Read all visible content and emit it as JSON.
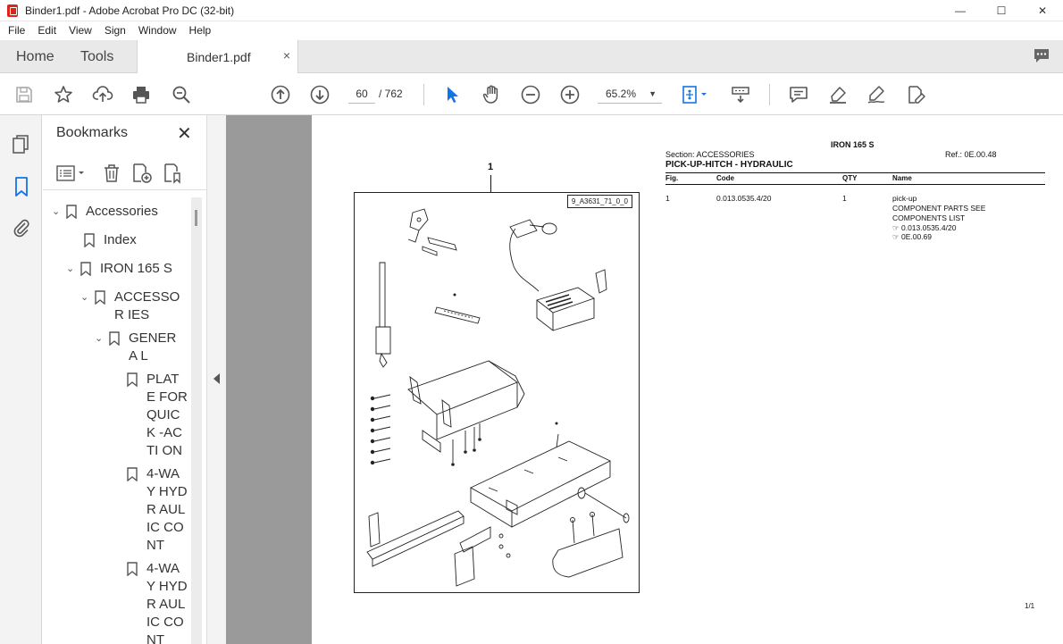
{
  "window": {
    "title": "Binder1.pdf - Adobe Acrobat Pro DC (32-bit)",
    "controls": [
      "—",
      "☐",
      "✕"
    ]
  },
  "menu": [
    "File",
    "Edit",
    "View",
    "Sign",
    "Window",
    "Help"
  ],
  "tabs": {
    "home": "Home",
    "tools": "Tools",
    "document": "Binder1.pdf",
    "close": "×"
  },
  "toolbar": {
    "page_current": "60",
    "page_total": "/  762",
    "zoom": "65.2%",
    "zoom_caret": "▼",
    "icons": [
      "save-icon",
      "star-icon",
      "upload-icon",
      "print-icon",
      "search-icon",
      "page-up-icon",
      "page-down-icon",
      "select-cursor-icon",
      "hand-icon",
      "zoom-out-icon",
      "zoom-in-icon",
      "fit-page-icon",
      "scroll-mode-icon",
      "comment-icon",
      "highlight-icon",
      "sign-icon",
      "edit-pdf-icon"
    ]
  },
  "bookmarks": {
    "title": "Bookmarks",
    "close": "✕",
    "items": [
      {
        "label": "Accessories",
        "chev": "⌄"
      },
      {
        "label": "Index",
        "chev": ""
      },
      {
        "label": "IRON 165 S",
        "chev": "⌄"
      },
      {
        "label": "ACCESSOR IES",
        "chev": "⌄"
      },
      {
        "label": "GENERA L",
        "chev": "⌄"
      },
      {
        "label": "PLATE FOR QUICK -ACTI ON",
        "chev": ""
      },
      {
        "label": "4-WA Y HYDR AULIC CONT",
        "chev": ""
      },
      {
        "label": "4-WA Y HYDR AULIC CONT",
        "chev": ""
      }
    ]
  },
  "pdf": {
    "model": "IRON 165 S",
    "section": "Section: ACCESSORIES",
    "ref": "Ref.: 0E.00.48",
    "heading": "PICK-UP-HITCH - HYDRAULIC",
    "columns": [
      "Fig.",
      "Code",
      "QTY",
      "Name"
    ],
    "row": {
      "fig": "1",
      "code": "0.013.0535.4/20",
      "qty": "1",
      "name_lines": [
        "pick-up",
        "COMPONENT PARTS SEE",
        "COMPONENTS LIST",
        "☞ 0.013.0535.4/20",
        "☞ 0E.00.69"
      ]
    },
    "figure_number": "1",
    "figure_label": "9_A3631_71_0_0",
    "page_footer": "1/1"
  }
}
